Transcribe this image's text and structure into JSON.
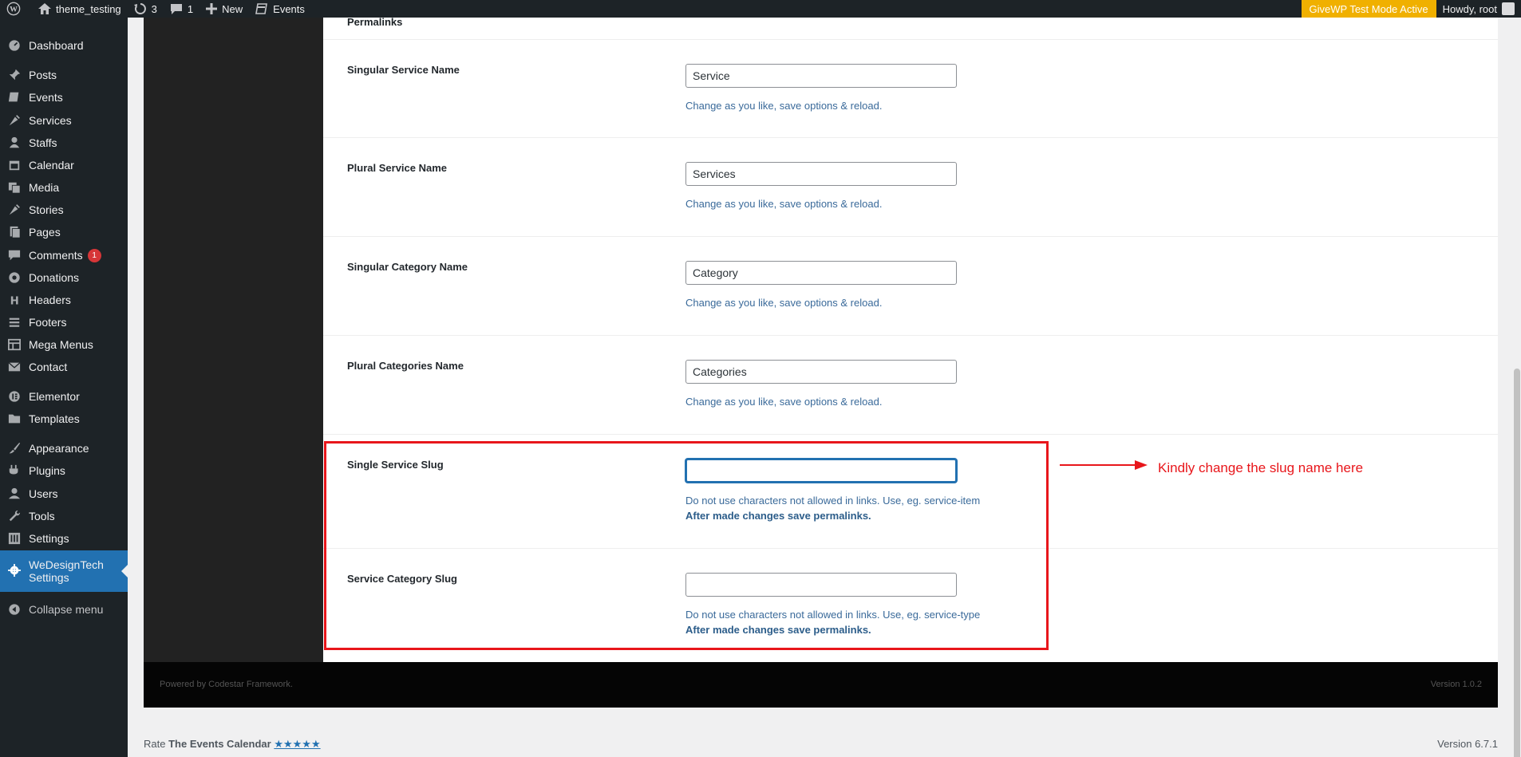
{
  "adminbar": {
    "site_name": "theme_testing",
    "updates_count": "3",
    "comments_count": "1",
    "new_label": "New",
    "events_label": "Events",
    "givewp_notice": "GiveWP Test Mode Active",
    "howdy": "Howdy, root"
  },
  "sidebar": {
    "items": [
      {
        "label": "Dashboard",
        "icon": "dashboard-icon"
      },
      {
        "label": "Posts",
        "icon": "pushpin-icon"
      },
      {
        "label": "Events",
        "icon": "calendar-flag-icon"
      },
      {
        "label": "Services",
        "icon": "carrot-icon"
      },
      {
        "label": "Staffs",
        "icon": "person-icon"
      },
      {
        "label": "Calendar",
        "icon": "calendar-icon"
      },
      {
        "label": "Media",
        "icon": "media-icon"
      },
      {
        "label": "Stories",
        "icon": "carrot-icon"
      },
      {
        "label": "Pages",
        "icon": "pages-icon"
      },
      {
        "label": "Comments",
        "icon": "comment-icon",
        "badge": "1"
      },
      {
        "label": "Donations",
        "icon": "give-icon"
      },
      {
        "label": "Headers",
        "icon": "heading-icon"
      },
      {
        "label": "Footers",
        "icon": "list-icon"
      },
      {
        "label": "Mega Menus",
        "icon": "table-icon"
      },
      {
        "label": "Contact",
        "icon": "email-icon"
      },
      {
        "label": "Elementor",
        "icon": "elementor-icon"
      },
      {
        "label": "Templates",
        "icon": "folder-icon"
      },
      {
        "label": "Appearance",
        "icon": "brush-icon"
      },
      {
        "label": "Plugins",
        "icon": "plug-icon"
      },
      {
        "label": "Users",
        "icon": "users-icon"
      },
      {
        "label": "Tools",
        "icon": "wrench-icon"
      },
      {
        "label": "Settings",
        "icon": "sliders-icon"
      },
      {
        "label": "WeDesignTech Settings",
        "icon": "gear-icon"
      }
    ],
    "collapse_label": "Collapse menu"
  },
  "panel": {
    "section_title": "Permalinks",
    "fields": [
      {
        "label": "Singular Service Name",
        "value": "Service",
        "help": "Change as you like, save options & reload."
      },
      {
        "label": "Plural Service Name",
        "value": "Services",
        "help": "Change as you like, save options & reload."
      },
      {
        "label": "Singular Category Name",
        "value": "Category",
        "help": "Change as you like, save options & reload."
      },
      {
        "label": "Plural Categories Name",
        "value": "Categories",
        "help": "Change as you like, save options & reload."
      },
      {
        "label": "Single Service Slug",
        "value": "",
        "help": "Do not use characters not allowed in links. Use, eg. service-item",
        "help2": "After made changes save permalinks."
      },
      {
        "label": "Service Category Slug",
        "value": "",
        "help": "Do not use characters not allowed in links. Use, eg. service-type",
        "help2": "After made changes save permalinks."
      }
    ]
  },
  "framework_footer": {
    "powered": "Powered by Codestar Framework.",
    "version": "Version 1.0.2"
  },
  "annotation": {
    "text": "Kindly change the slug name here",
    "color": "#e8161b"
  },
  "wp_footer": {
    "rate_prefix": "Rate",
    "plugin_name": "The Events Calendar",
    "stars": "★★★★★",
    "version": "Version 6.7.1"
  }
}
